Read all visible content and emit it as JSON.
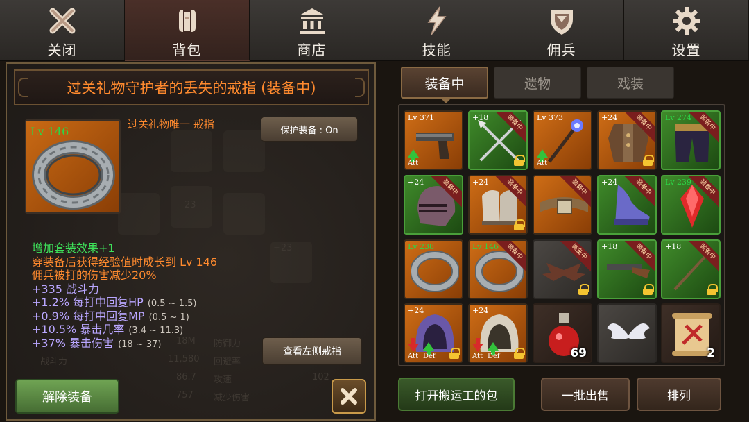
{
  "nav": {
    "tabs": [
      {
        "label": "关闭",
        "icon": "close-icon"
      },
      {
        "label": "背包",
        "icon": "backpack-icon"
      },
      {
        "label": "商店",
        "icon": "shop-icon"
      },
      {
        "label": "技能",
        "icon": "skill-icon"
      },
      {
        "label": "佣兵",
        "icon": "mercenary-shield-icon"
      },
      {
        "label": "设置",
        "icon": "gear-icon"
      }
    ],
    "active": "背包"
  },
  "detail": {
    "title": "过关礼物守护者的丢失的戒指 (装备中)",
    "level": "Lv 146",
    "subtitle": "过关礼物唯一 戒指",
    "protect_button": "保护装备 : On",
    "stats": [
      {
        "text": "增加套装效果+1",
        "color": "green",
        "range": ""
      },
      {
        "text": "穿装备后获得经验值时成长到 Lv 146",
        "color": "orange",
        "range": ""
      },
      {
        "text": "佣兵被打的伤害减少20%",
        "color": "orange",
        "range": ""
      },
      {
        "text": "+335 战斗力",
        "color": "purple",
        "range": ""
      },
      {
        "text": "+1.2% 每打中回复HP",
        "color": "purple",
        "range": "(0.5 ~ 1.5)"
      },
      {
        "text": "+0.9% 每打中回复MP",
        "color": "purple",
        "range": "(0.5 ~ 1)"
      },
      {
        "text": "+10.5% 暴击几率",
        "color": "purple",
        "range": "(3.4 ~ 11.3)"
      },
      {
        "text": "+37% 暴击伤害",
        "color": "purple",
        "range": "(18 ~ 37)"
      }
    ],
    "check_left_ring_button": "查看左侧戒指",
    "unequip_button": "解除装备",
    "background_ghost_text": [
      "18M",
      "防御力",
      "战斗力",
      "11,580",
      "回避率",
      "86.7",
      "攻速",
      "102",
      "757",
      "减少伤害",
      "+23",
      "23"
    ]
  },
  "inventory": {
    "tabs": [
      "装备中",
      "遗物",
      "戏装"
    ],
    "active_tab": "装备中",
    "equipped_label": "装备中",
    "slots": [
      {
        "name": "pistol",
        "bg": "orange",
        "label": "Lv 371",
        "label_color": "white",
        "equipped": false,
        "locked": false,
        "tags": [
          "Att"
        ],
        "arrows": [
          "up"
        ],
        "count": ""
      },
      {
        "name": "crossed-arrows",
        "bg": "green",
        "label": "+18",
        "label_color": "white",
        "equipped": true,
        "locked": true,
        "tags": [],
        "arrows": [],
        "count": ""
      },
      {
        "name": "magic-staff",
        "bg": "orange",
        "label": "Lv 373",
        "label_color": "white",
        "equipped": false,
        "locked": false,
        "tags": [
          "Att"
        ],
        "arrows": [
          "up"
        ],
        "count": ""
      },
      {
        "name": "leather-armor",
        "bg": "orange",
        "label": "+24",
        "label_color": "white",
        "equipped": true,
        "locked": true,
        "tags": [],
        "arrows": [],
        "count": ""
      },
      {
        "name": "dark-pants",
        "bg": "green",
        "label": "Lv 274",
        "label_color": "green",
        "equipped": true,
        "locked": false,
        "tags": [],
        "arrows": [],
        "count": ""
      },
      {
        "name": "knight-helmet",
        "bg": "green",
        "label": "+24",
        "label_color": "white",
        "equipped": true,
        "locked": false,
        "tags": [],
        "arrows": [],
        "count": ""
      },
      {
        "name": "gauntlets",
        "bg": "orange",
        "label": "+24",
        "label_color": "white",
        "equipped": true,
        "locked": true,
        "tags": [],
        "arrows": [],
        "count": ""
      },
      {
        "name": "belt",
        "bg": "orange",
        "label": "",
        "label_color": "white",
        "equipped": true,
        "locked": false,
        "tags": [],
        "arrows": [],
        "count": ""
      },
      {
        "name": "wizard-boots",
        "bg": "green",
        "label": "+24",
        "label_color": "white",
        "equipped": true,
        "locked": false,
        "tags": [],
        "arrows": [],
        "count": ""
      },
      {
        "name": "red-gem-amulet",
        "bg": "green",
        "label": "Lv 239",
        "label_color": "green",
        "equipped": true,
        "locked": false,
        "tags": [],
        "arrows": [],
        "count": ""
      },
      {
        "name": "ring",
        "bg": "orange",
        "label": "Lv 238",
        "label_color": "green",
        "equipped": false,
        "locked": false,
        "tags": [],
        "arrows": [],
        "count": ""
      },
      {
        "name": "ring",
        "bg": "orange",
        "label": "Lv 146",
        "label_color": "green",
        "equipped": true,
        "locked": false,
        "tags": [],
        "arrows": [],
        "count": ""
      },
      {
        "name": "bat-wings",
        "bg": "gray",
        "label": "",
        "label_color": "white",
        "equipped": true,
        "locked": true,
        "tags": [],
        "arrows": [],
        "count": ""
      },
      {
        "name": "shotgun",
        "bg": "green",
        "label": "+18",
        "label_color": "white",
        "equipped": true,
        "locked": true,
        "tags": [],
        "arrows": [],
        "count": ""
      },
      {
        "name": "spear",
        "bg": "green",
        "label": "+18",
        "label_color": "white",
        "equipped": true,
        "locked": true,
        "tags": [],
        "arrows": [],
        "count": ""
      },
      {
        "name": "purple-hood",
        "bg": "orange",
        "label": "+24",
        "label_color": "white",
        "equipped": false,
        "locked": true,
        "tags": [
          "Att",
          "Def"
        ],
        "arrows": [
          "down",
          "up"
        ],
        "count": ""
      },
      {
        "name": "white-hood",
        "bg": "orange",
        "label": "+24",
        "label_color": "white",
        "equipped": false,
        "locked": true,
        "tags": [
          "Att",
          "Def"
        ],
        "arrows": [
          "down",
          "up"
        ],
        "count": ""
      },
      {
        "name": "red-potion",
        "bg": "dark",
        "label": "",
        "label_color": "white",
        "equipped": false,
        "locked": false,
        "tags": [],
        "arrows": [],
        "count": "69"
      },
      {
        "name": "angel-wings",
        "bg": "gray",
        "label": "",
        "label_color": "white",
        "equipped": false,
        "locked": false,
        "tags": [],
        "arrows": [],
        "count": ""
      },
      {
        "name": "scroll",
        "bg": "dark",
        "label": "",
        "label_color": "white",
        "equipped": false,
        "locked": false,
        "tags": [],
        "arrows": [],
        "count": "2"
      }
    ],
    "buttons": {
      "porter_bag": "打开搬运工的包",
      "bulk_sell": "一批出售",
      "sort": "排列"
    }
  },
  "colors": {
    "accent_orange": "#ff8a2e",
    "stat_green": "#3ee25a",
    "stat_purple": "#b9a6ff",
    "level_green": "#2cd646"
  }
}
